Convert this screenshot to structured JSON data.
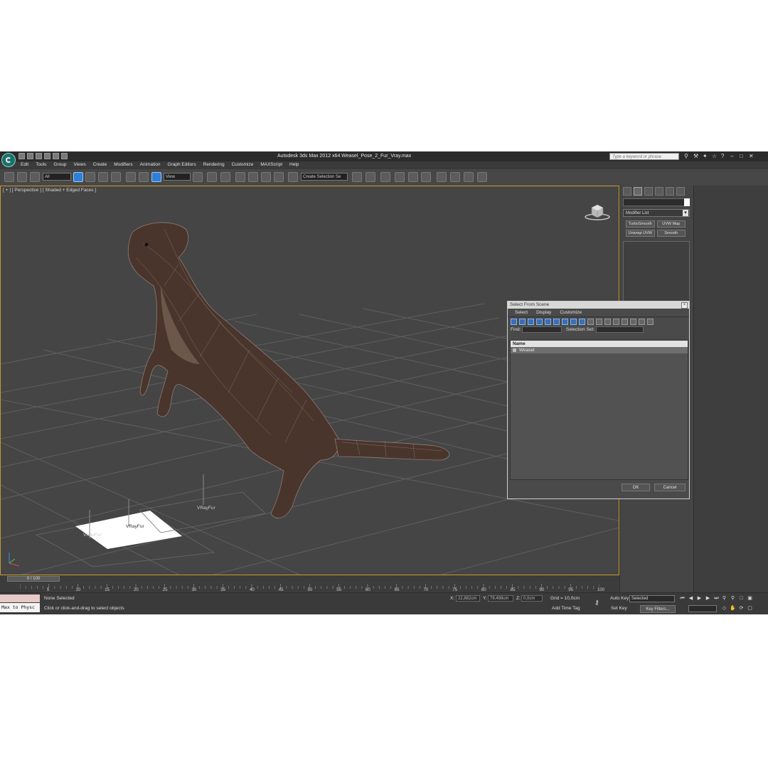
{
  "window": {
    "title": "Autodesk 3ds Max  2012 x64     Weasel_Pose_2_Fur_Vray.max",
    "search_placeholder": "Type a keyword or phrase"
  },
  "menu": [
    "Edit",
    "Tools",
    "Group",
    "Views",
    "Create",
    "Modifiers",
    "Animation",
    "Graph Editors",
    "Rendering",
    "Customize",
    "MAXScript",
    "Help"
  ],
  "toolbar": {
    "filter_value": "All",
    "refcoord_value": "View",
    "selection_set_value": "Create Selection Se"
  },
  "viewport": {
    "label": "[ + ] [ Perspective ] [ Shaded + Edged Faces ]",
    "fur_labels": [
      "VRayFur",
      "VRayFur",
      "VRayFur"
    ]
  },
  "command_panel": {
    "modifier_list_label": "Modifier List",
    "modifier_buttons": [
      "TurboSmooth",
      "UVW Map",
      "Unwrap UVW",
      "Smooth"
    ]
  },
  "dialog": {
    "title": "Select From Scene",
    "menu": [
      "Select",
      "Display",
      "Customize"
    ],
    "find_label": "Find:",
    "selection_set_label": "Selection Set:",
    "column_name": "Name",
    "rows": [
      "Weasel"
    ],
    "ok_label": "OK",
    "cancel_label": "Cancel"
  },
  "timeline": {
    "frame_display": "0 / 100",
    "tick_labels": [
      "5",
      "10",
      "15",
      "20",
      "25",
      "30",
      "35",
      "40",
      "45",
      "50",
      "55",
      "60",
      "65",
      "70",
      "75",
      "80",
      "85",
      "90",
      "95",
      "100"
    ]
  },
  "status": {
    "maxscript_text": "Max to Physc",
    "selection_status": "None Selected",
    "prompt": "Click or click-and-drag to select objects",
    "x_label": "X:",
    "x_value": "22,882cm",
    "y_label": "Y:",
    "y_value": "79,498cm",
    "z_label": "Z:",
    "z_value": "0,0cm",
    "grid": "Grid = 10,0cm",
    "add_time_tag": "Add Time Tag",
    "auto_key": "Auto Key",
    "set_key": "Set Key",
    "selected_dropdown": "Selected",
    "key_filters": "Key Filters..."
  }
}
